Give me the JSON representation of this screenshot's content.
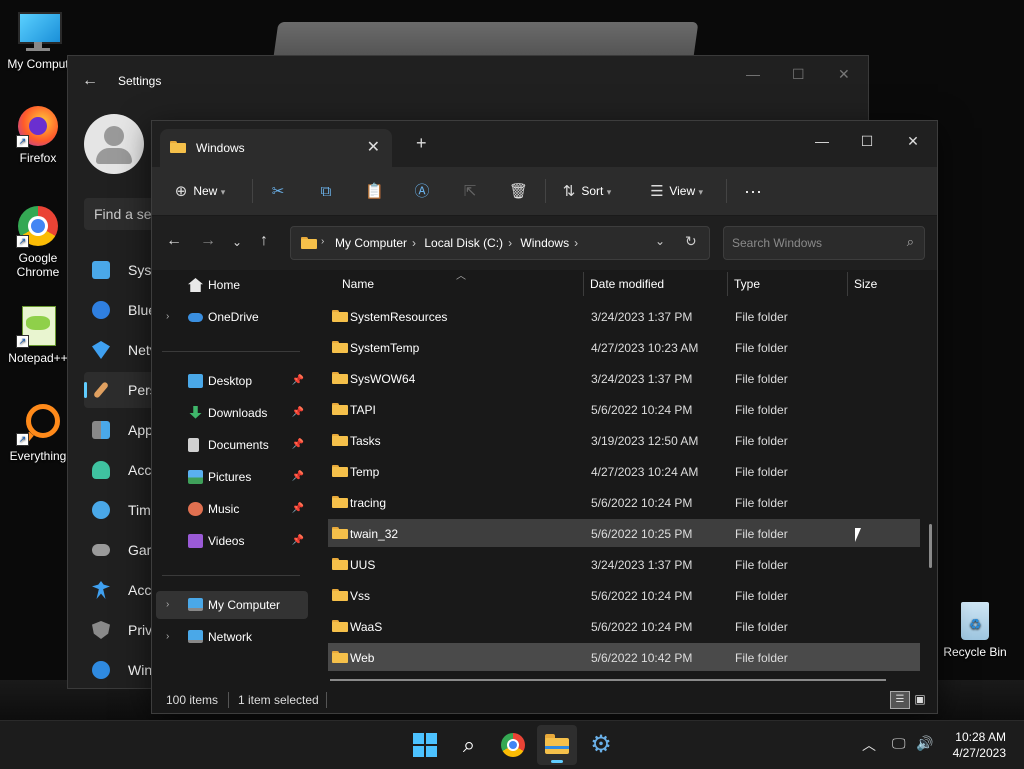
{
  "desktop": {
    "icons": [
      {
        "label": "My Comput"
      },
      {
        "label": "Firefox"
      },
      {
        "label": "Google Chrome"
      },
      {
        "label": "Notepad++"
      },
      {
        "label": "Everything"
      },
      {
        "label": "Recycle Bin"
      }
    ]
  },
  "settings": {
    "title": "Settings",
    "search_placeholder": "Find a set",
    "nav": [
      "Syst",
      "Blue",
      "Netv",
      "Pers",
      "App",
      "Acco",
      "Time",
      "Gam",
      "Acce",
      "Priva",
      "Win"
    ]
  },
  "explorer": {
    "tab_title": "Windows",
    "commands": {
      "new": "New",
      "sort": "Sort",
      "view": "View"
    },
    "breadcrumb": [
      "My Computer",
      "Local Disk (C:)",
      "Windows"
    ],
    "search_placeholder": "Search Windows",
    "sidebar": {
      "home": "Home",
      "onedrive": "OneDrive",
      "quick": [
        "Desktop",
        "Downloads",
        "Documents",
        "Pictures",
        "Music",
        "Videos"
      ],
      "mycomputer": "My Computer",
      "network": "Network"
    },
    "columns": {
      "name": "Name",
      "date": "Date modified",
      "type": "Type",
      "size": "Size"
    },
    "rows": [
      {
        "name": "SystemResources",
        "date": "3/24/2023 1:37 PM",
        "type": "File folder"
      },
      {
        "name": "SystemTemp",
        "date": "4/27/2023 10:23 AM",
        "type": "File folder"
      },
      {
        "name": "SysWOW64",
        "date": "3/24/2023 1:37 PM",
        "type": "File folder"
      },
      {
        "name": "TAPI",
        "date": "5/6/2022 10:24 PM",
        "type": "File folder"
      },
      {
        "name": "Tasks",
        "date": "3/19/2023 12:50 AM",
        "type": "File folder"
      },
      {
        "name": "Temp",
        "date": "4/27/2023 10:24 AM",
        "type": "File folder"
      },
      {
        "name": "tracing",
        "date": "5/6/2022 10:24 PM",
        "type": "File folder"
      },
      {
        "name": "twain_32",
        "date": "5/6/2022 10:25 PM",
        "type": "File folder"
      },
      {
        "name": "UUS",
        "date": "3/24/2023 1:37 PM",
        "type": "File folder"
      },
      {
        "name": "Vss",
        "date": "5/6/2022 10:24 PM",
        "type": "File folder"
      },
      {
        "name": "WaaS",
        "date": "5/6/2022 10:24 PM",
        "type": "File folder"
      },
      {
        "name": "Web",
        "date": "5/6/2022 10:42 PM",
        "type": "File folder"
      }
    ],
    "status": {
      "items": "100 items",
      "selected": "1 item selected"
    }
  },
  "taskbar": {
    "time": "10:28 AM",
    "date": "4/27/2023"
  },
  "colors": {
    "accent": "#60cdff",
    "folder": "#f5c04a"
  }
}
